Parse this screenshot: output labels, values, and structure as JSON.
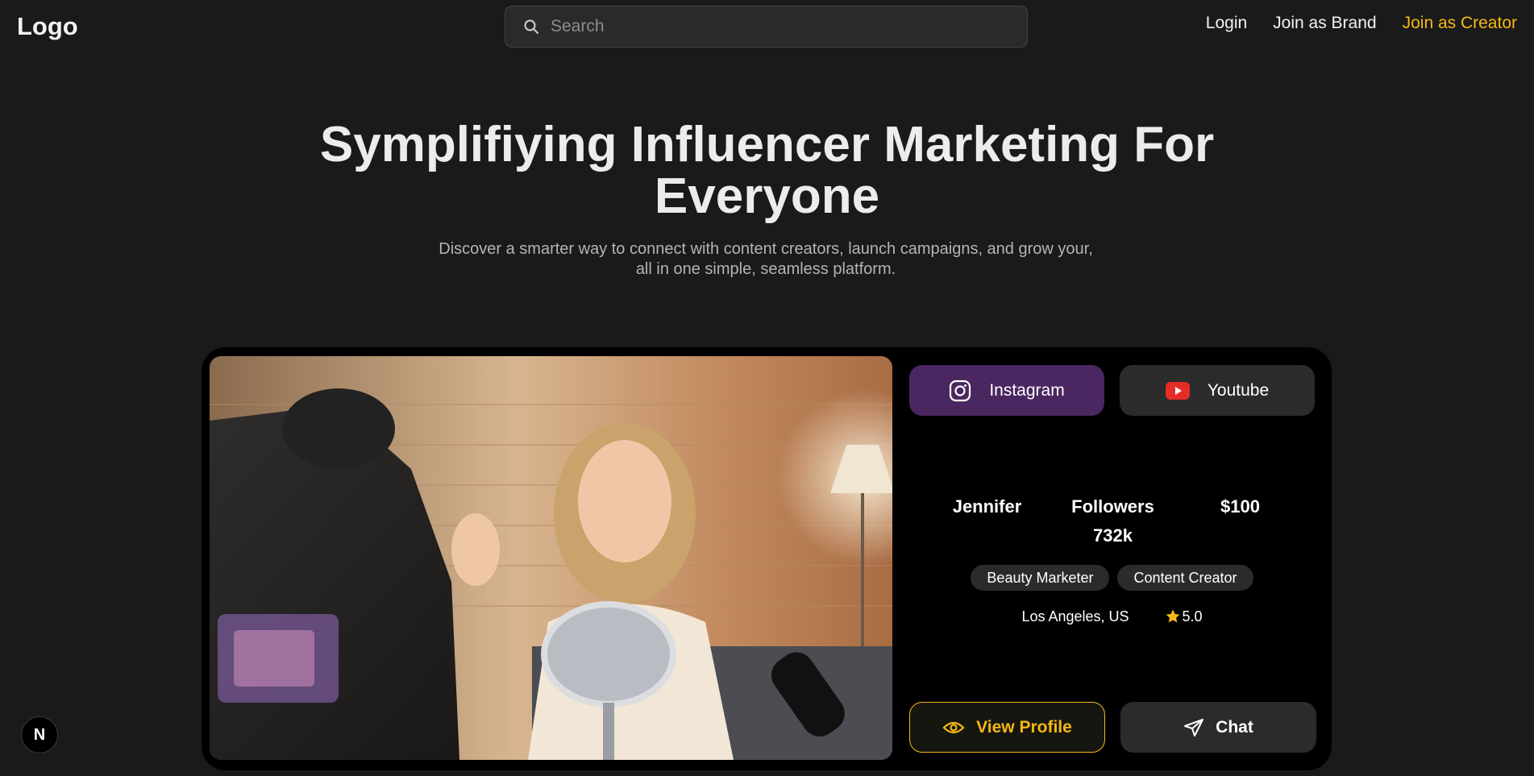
{
  "header": {
    "logo": "Logo",
    "search_placeholder": "Search",
    "nav": {
      "login": "Login",
      "join_brand": "Join as Brand",
      "join_creator": "Join as Creator"
    }
  },
  "hero": {
    "title_line1": "Symplifiying Influencer Marketing For",
    "title_line2": "Everyone",
    "subtitle": "Discover a smarter way to connect with content creators, launch campaigns, and grow your, all in one simple, seamless platform."
  },
  "card": {
    "platforms": {
      "instagram": "Instagram",
      "youtube": "Youtube"
    },
    "creator": {
      "name": "Jennifer",
      "followers_label": "Followers",
      "followers_value": "732k",
      "price": "$100",
      "tags": [
        "Beauty Marketer",
        "Content Creator"
      ],
      "location": "Los Angeles, US",
      "rating": "5.0"
    },
    "actions": {
      "view_profile": "View Profile",
      "chat": "Chat"
    }
  },
  "badge": {
    "letter": "N"
  },
  "colors": {
    "background": "#1a1a1a",
    "accent": "#f5b914",
    "instagram_button": "#4a2760",
    "button_dark": "#2b2b2b",
    "youtube_red": "#e52d27"
  },
  "icons": {
    "search": "search-icon",
    "instagram": "instagram-icon",
    "youtube": "youtube-icon",
    "star": "star-icon",
    "eye": "eye-icon",
    "send": "send-icon"
  }
}
